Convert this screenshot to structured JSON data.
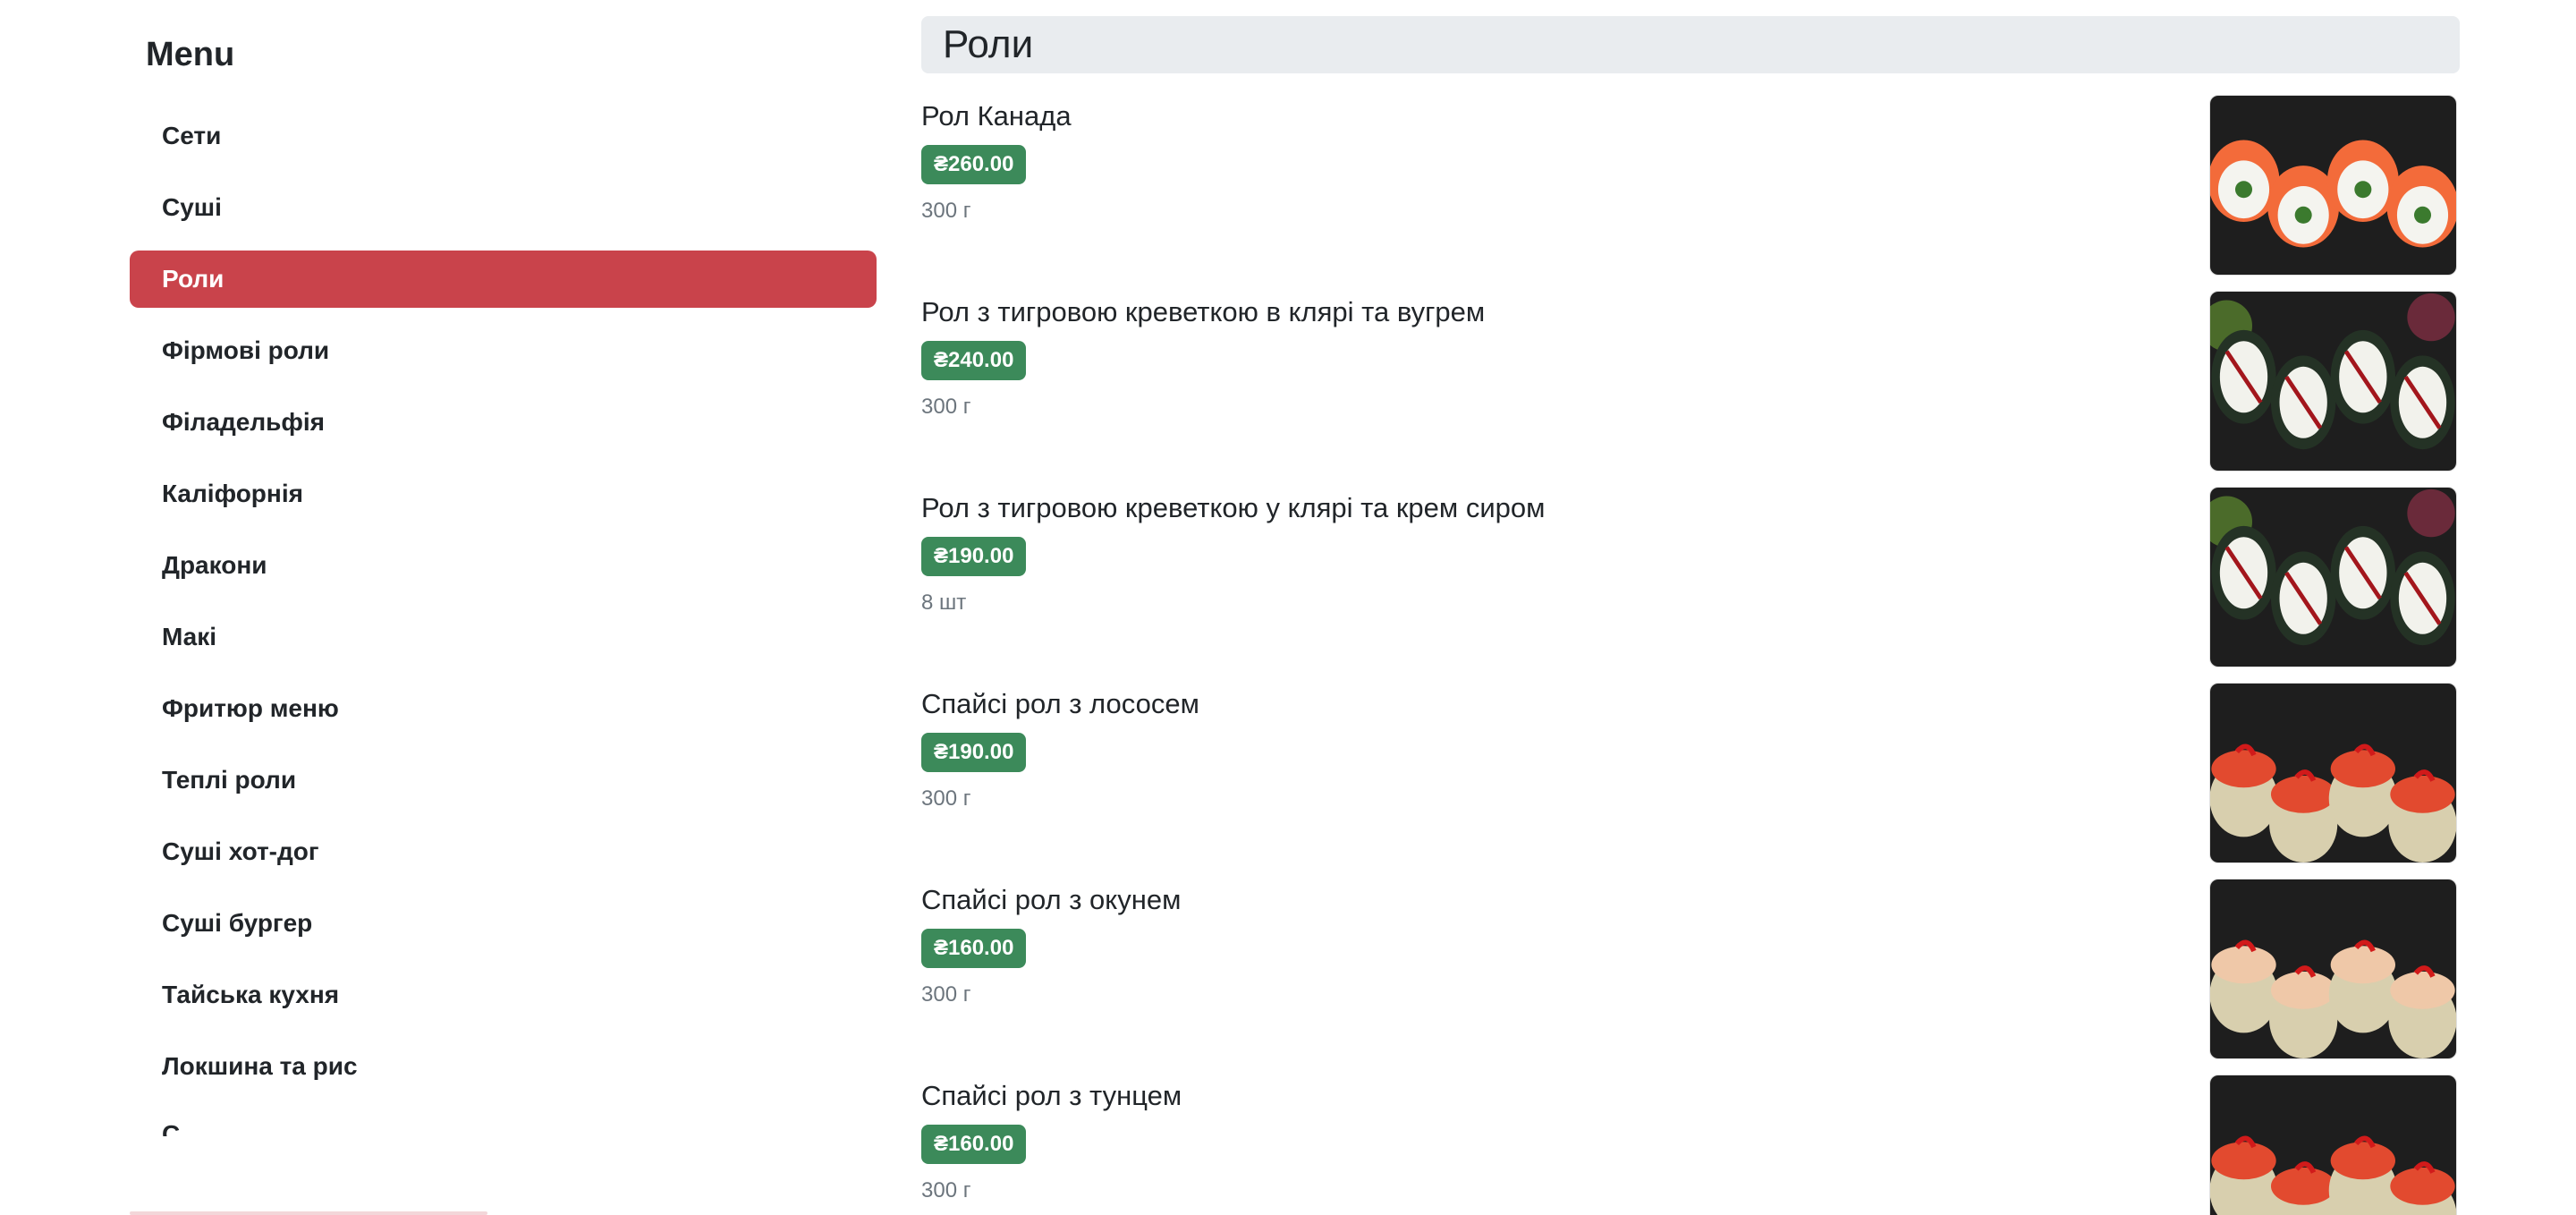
{
  "sidebar": {
    "title": "Menu",
    "items": [
      {
        "label": "Сети",
        "active": false
      },
      {
        "label": "Суші",
        "active": false
      },
      {
        "label": "Роли",
        "active": true
      },
      {
        "label": "Фірмові роли",
        "active": false
      },
      {
        "label": "Філадельфія",
        "active": false
      },
      {
        "label": "Каліфорнія",
        "active": false
      },
      {
        "label": "Дракони",
        "active": false
      },
      {
        "label": "Макі",
        "active": false
      },
      {
        "label": "Фритюр меню",
        "active": false
      },
      {
        "label": "Теплі роли",
        "active": false
      },
      {
        "label": "Суші хот-дог",
        "active": false
      },
      {
        "label": "Суші бургер",
        "active": false
      },
      {
        "label": "Тайська кухня",
        "active": false
      },
      {
        "label": "Локшина та рис",
        "active": false
      }
    ],
    "partial_item": "С",
    "accent_color": "#c9434b"
  },
  "section": {
    "title": "Роли"
  },
  "products": [
    {
      "name": "Рол Канада",
      "price": "₴260.00",
      "weight": "300 г",
      "image_icon": "salmon-roll-image"
    },
    {
      "name": "Рол з тигровою креветкою в клярі та вугрем",
      "price": "₴240.00",
      "weight": "300 г",
      "image_icon": "shrimp-eel-roll-image"
    },
    {
      "name": "Рол з тигровою креветкою у клярі та крем сиром",
      "price": "₴190.00",
      "weight": "8 шт",
      "image_icon": "shrimp-cream-cheese-roll-image"
    },
    {
      "name": "Спайсі рол з лососем",
      "price": "₴190.00",
      "weight": "300 г",
      "image_icon": "spicy-salmon-roll-image"
    },
    {
      "name": "Спайсі рол з окунем",
      "price": "₴160.00",
      "weight": "300 г",
      "image_icon": "spicy-perch-roll-image"
    },
    {
      "name": "Спайсі рол з тунцем",
      "price": "₴160.00",
      "weight": "300 г",
      "image_icon": "spicy-tuna-roll-image"
    }
  ],
  "colors": {
    "price_badge": "#3c8a5a",
    "section_header_bg": "#e9ecef"
  }
}
